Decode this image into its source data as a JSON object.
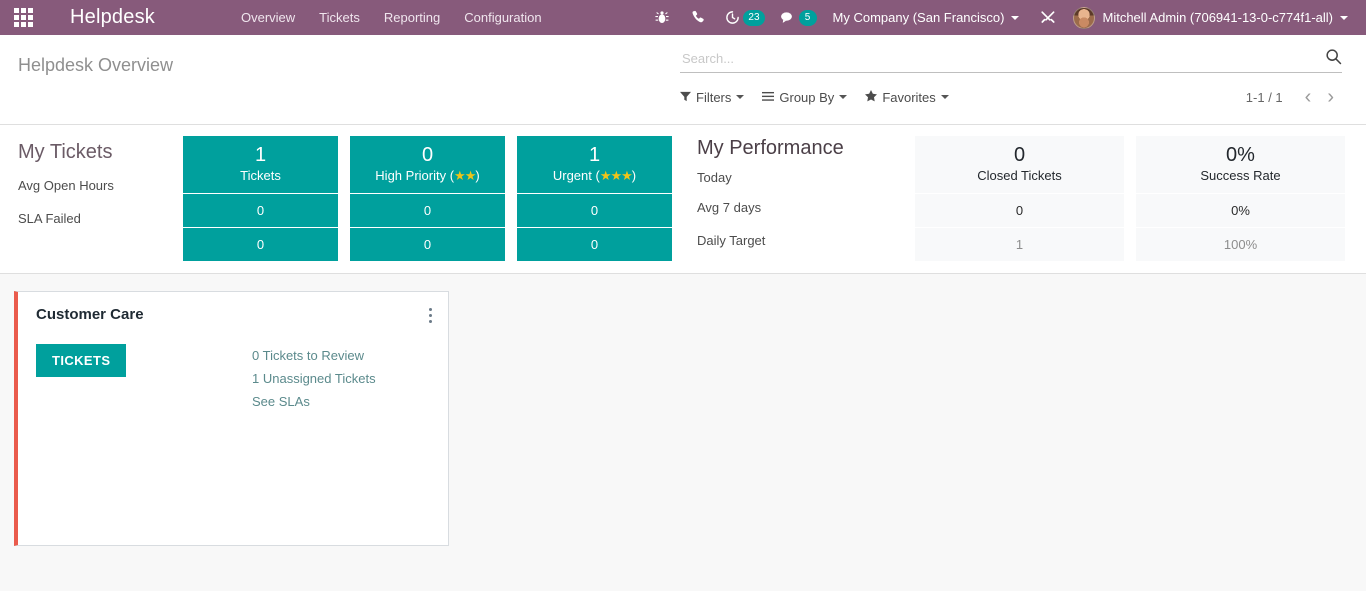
{
  "navbar": {
    "apps_icon": "apps-grid-icon",
    "brand": "Helpdesk",
    "menu": [
      {
        "label": "Overview"
      },
      {
        "label": "Tickets"
      },
      {
        "label": "Reporting"
      },
      {
        "label": "Configuration"
      }
    ],
    "icons": {
      "bug": "bug-icon",
      "phone": "phone-icon",
      "activity": "clock-activity-icon",
      "messaging": "chat-bubble-icon",
      "tools": "tools-icon"
    },
    "activity_count": "23",
    "message_count": "5",
    "company": "My Company (San Francisco)",
    "user": "Mitchell Admin (706941-13-0-c774f1-all)"
  },
  "control_panel": {
    "title": "Helpdesk Overview",
    "search": {
      "value": "",
      "placeholder": "Search..."
    },
    "tools": [
      {
        "label": "Filters",
        "icon": "filter-icon"
      },
      {
        "label": "Group By",
        "icon": "bars-icon"
      },
      {
        "label": "Favorites",
        "icon": "star-icon"
      }
    ],
    "pager": {
      "count": "1-1 / 1",
      "prev": "‹",
      "next": "›"
    }
  },
  "my_tickets": {
    "title": "My Tickets",
    "row_labels": [
      "Avg Open Hours",
      "SLA Failed"
    ],
    "columns": [
      {
        "value": "1",
        "name": "Tickets",
        "stars": "",
        "avg_open_hours": "0",
        "sla_failed": "0"
      },
      {
        "value": "0",
        "name": "High Priority (",
        "stars": "★★",
        "name_suffix": ")",
        "avg_open_hours": "0",
        "sla_failed": "0"
      },
      {
        "value": "1",
        "name": "Urgent (",
        "stars": "★★★",
        "name_suffix": ")",
        "avg_open_hours": "0",
        "sla_failed": "0"
      }
    ]
  },
  "my_performance": {
    "title": "My Performance",
    "row_labels": [
      "Today",
      "Avg 7 days",
      "Daily Target"
    ],
    "columns": [
      {
        "value": "0",
        "name": "Closed Tickets",
        "avg_7_days": "0",
        "daily_target": "1"
      },
      {
        "value": "0%",
        "name": "Success Rate",
        "avg_7_days": "0%",
        "daily_target": "100%"
      }
    ]
  },
  "teams": [
    {
      "name": "Customer Care",
      "accent_color": "#ea5b4c",
      "button_label": "TICKETS",
      "links": [
        "0 Tickets to Review",
        "1 Unassigned Tickets",
        "See SLAs"
      ]
    }
  ],
  "colors": {
    "navbar": "#875a7b",
    "teal": "#00a09d",
    "accent_red": "#ea5b4c",
    "star_gold": "#f0c419",
    "page_bg": "#f8f8f8"
  }
}
